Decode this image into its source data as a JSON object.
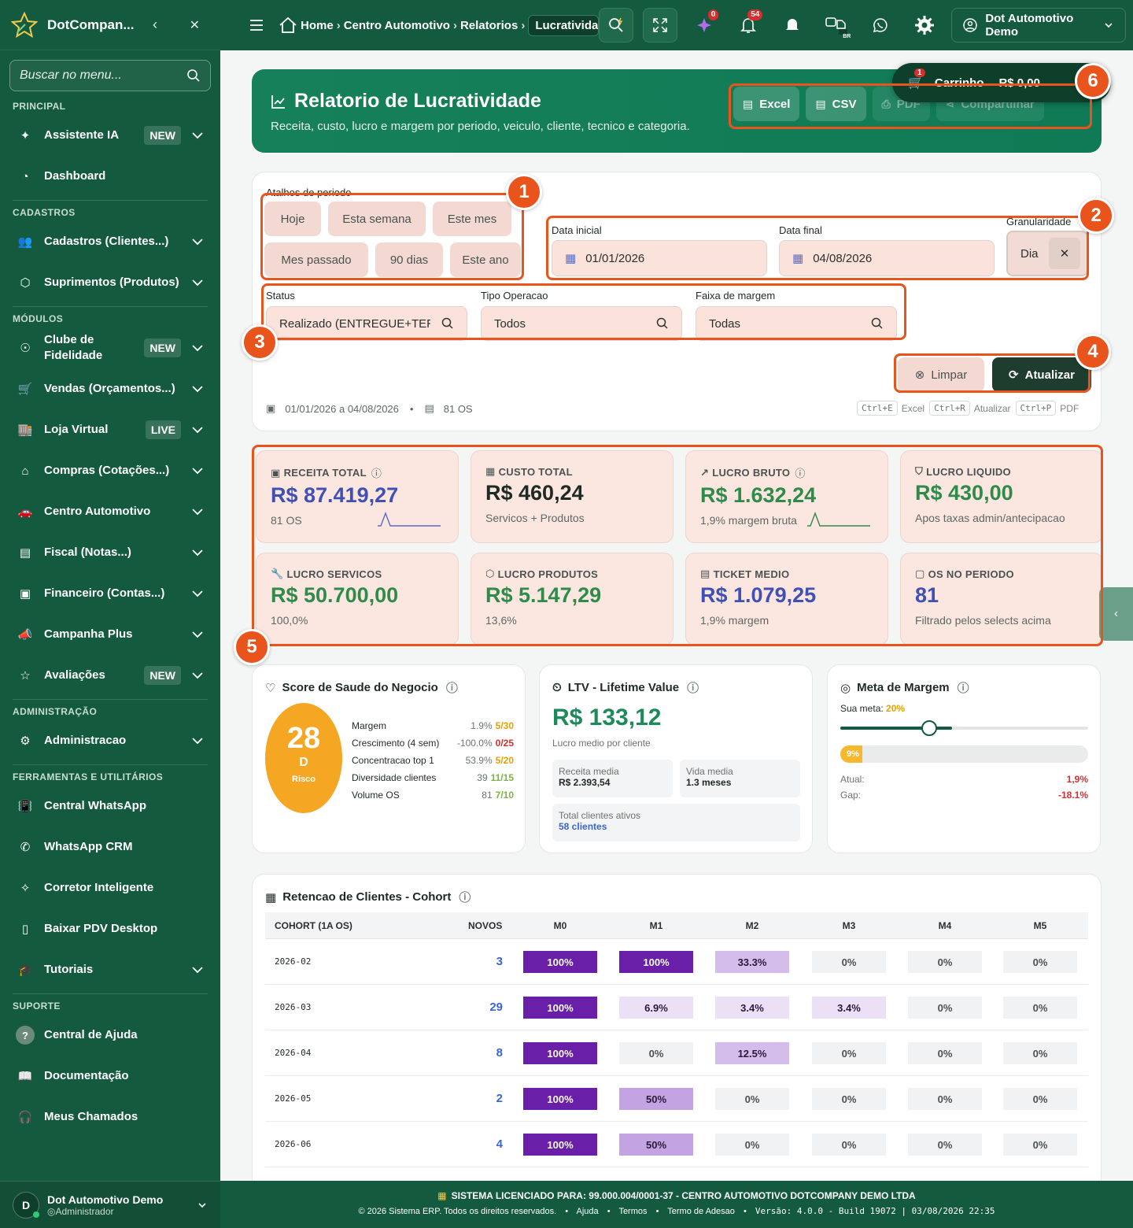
{
  "sidebar": {
    "brand": "DotCompan...",
    "search_placeholder": "Buscar no menu...",
    "sections": [
      "PRINCIPAL",
      "CADASTROS",
      "MÓDULOS",
      "ADMINISTRAÇÃO",
      "FERRAMENTAS E UTILITÁRIOS",
      "SUPORTE"
    ],
    "items": [
      {
        "label": "Assistente IA",
        "badge": "NEW",
        "icon": "sparkle-icon"
      },
      {
        "label": "Dashboard",
        "icon": "gauge-icon"
      },
      {
        "label": "Cadastros (Clientes...)",
        "icon": "users-icon"
      },
      {
        "label": "Suprimentos (Produtos)",
        "icon": "box-icon"
      },
      {
        "label": "Clube de Fidelidade",
        "badge": "NEW",
        "icon": "medal-icon"
      },
      {
        "label": "Vendas (Orçamentos...)",
        "icon": "cart-icon"
      },
      {
        "label": "Loja Virtual",
        "badge": "LIVE",
        "icon": "store-icon"
      },
      {
        "label": "Compras (Cotações...)",
        "icon": "basket-icon"
      },
      {
        "label": "Centro Automotivo",
        "icon": "car-icon"
      },
      {
        "label": "Fiscal (Notas...)",
        "icon": "receipt-icon"
      },
      {
        "label": "Financeiro (Contas...)",
        "icon": "cash-icon"
      },
      {
        "label": "Campanha Plus",
        "icon": "megaphone-icon"
      },
      {
        "label": "Avaliações",
        "badge": "NEW",
        "icon": "star-icon"
      },
      {
        "label": "Administracao",
        "icon": "gear-icon"
      },
      {
        "label": "Central WhatsApp",
        "icon": "vibrate-icon"
      },
      {
        "label": "WhatsApp CRM",
        "icon": "whatsapp-icon"
      },
      {
        "label": "Corretor Inteligente",
        "icon": "wand-icon"
      },
      {
        "label": "Baixar PDV Desktop",
        "icon": "devices-icon"
      },
      {
        "label": "Tutoriais",
        "icon": "cap-icon"
      },
      {
        "label": "Central de Ajuda",
        "icon": "help-icon"
      },
      {
        "label": "Documentação",
        "icon": "book-icon"
      },
      {
        "label": "Meus Chamados",
        "icon": "headset-icon"
      }
    ],
    "user": {
      "initial": "D",
      "name": "Dot Automotivo Demo",
      "role": "Administrador"
    }
  },
  "topbar": {
    "breadcrumb": [
      "Home",
      "Centro Automotivo",
      "Relatorios",
      "Lucratividade"
    ],
    "counts": {
      "ai": "0",
      "notifications": "54"
    },
    "lang": "BR",
    "user": "Dot Automotivo Demo"
  },
  "cart": {
    "count": "1",
    "label": "Carrinho",
    "total": "R$ 0,00"
  },
  "hero": {
    "title": "Relatorio de Lucratividade",
    "subtitle": "Receita, custo, lucro e margem por periodo, veiculo, cliente, tecnico e categoria.",
    "actions": [
      "Excel",
      "CSV",
      "PDF",
      "Compartilhar"
    ]
  },
  "filters": {
    "shortcuts_label": "Atalhos de periodo",
    "shortcuts": [
      "Hoje",
      "Esta semana",
      "Este mes",
      "Mes passado",
      "90 dias",
      "Este ano"
    ],
    "date_start_label": "Data inicial",
    "date_start": "01/01/2026",
    "date_end_label": "Data final",
    "date_end": "04/08/2026",
    "granularity_label": "Granularidade",
    "granularity": "Dia",
    "status_label": "Status",
    "status": "Realizado (ENTREGUE+TERM",
    "op_label": "Tipo Operacao",
    "op": "Todos",
    "margin_label": "Faixa de margem",
    "margin": "Todas",
    "clear": "Limpar",
    "refresh": "Atualizar",
    "summary_range": "01/01/2026 a 04/08/2026",
    "summary_os": "81 OS",
    "shortcuts_keys": [
      {
        "key": "Ctrl+E",
        "label": "Excel"
      },
      {
        "key": "Ctrl+R",
        "label": "Atualizar"
      },
      {
        "key": "Ctrl+P",
        "label": "PDF"
      }
    ]
  },
  "annotations": [
    "1",
    "2",
    "3",
    "4",
    "5",
    "6"
  ],
  "kpis": [
    {
      "title": "RECEITA TOTAL",
      "value": "R$ 87.419,27",
      "sub": "81 OS",
      "color": "#3f51b5",
      "icon": "cash-icon"
    },
    {
      "title": "CUSTO TOTAL",
      "value": "R$ 460,24",
      "sub": "Servicos + Produtos",
      "color": "#1f2a24",
      "icon": "calculator-icon"
    },
    {
      "title": "LUCRO BRUTO",
      "value": "R$ 1.632,24",
      "sub": "1,9% margem bruta",
      "color": "#2e8b4a",
      "icon": "trend-icon"
    },
    {
      "title": "LUCRO LIQUIDO",
      "value": "R$ 430,00",
      "sub": "Apos taxas admin/antecipacao",
      "color": "#2e8b4a",
      "icon": "shield-icon"
    },
    {
      "title": "LUCRO SERVICOS",
      "value": "R$ 50.700,00",
      "sub": "100,0%",
      "color": "#2e8b4a",
      "icon": "wrench-icon"
    },
    {
      "title": "LUCRO PRODUTOS",
      "value": "R$ 5.147,29",
      "sub": "13,6%",
      "color": "#2e8b4a",
      "icon": "box-icon"
    },
    {
      "title": "TICKET MEDIO",
      "value": "R$ 1.079,25",
      "sub": "1,9% margem",
      "color": "#3f51b5",
      "icon": "receipt-icon"
    },
    {
      "title": "OS NO PERIODO",
      "value": "81",
      "sub": "Filtrado pelos selects acima",
      "color": "#3f51b5",
      "icon": "clipboard-icon"
    }
  ],
  "health": {
    "title": "Score de Saude do Negocio",
    "score": "28",
    "grade": "D",
    "status": "Risco",
    "rows": [
      {
        "label": "Margem",
        "value": "1.9%",
        "pts": "5/30",
        "color": "#e6a100"
      },
      {
        "label": "Crescimento (4 sem)",
        "value": "-100.0%",
        "pts": "0/25",
        "color": "#d32f2f"
      },
      {
        "label": "Concentracao top 1",
        "value": "53.9%",
        "pts": "5/20",
        "color": "#e6a100"
      },
      {
        "label": "Diversidade clientes",
        "value": "39",
        "pts": "11/15",
        "color": "#7cb342"
      },
      {
        "label": "Volume OS",
        "value": "81",
        "pts": "7/10",
        "color": "#7cb342"
      }
    ]
  },
  "ltv": {
    "title": "LTV - Lifetime Value",
    "value": "R$ 133,12",
    "caption": "Lucro medio por cliente",
    "rev_label": "Receita media",
    "rev": "R$ 2.393,54",
    "life_label": "Vida media",
    "life": "1.3 meses",
    "clients_label": "Total clientes ativos",
    "clients": "58 clientes"
  },
  "goal": {
    "title": "Meta de Margem",
    "meta_label": "Sua meta:",
    "meta": "20%",
    "meta_pct": 0.36,
    "bar_label": "9%",
    "bar_pct": 0.09,
    "atual_label": "Atual:",
    "atual": "1,9%",
    "gap_label": "Gap:",
    "gap": "-18.1%"
  },
  "cohort": {
    "title": "Retencao de Clientes - Cohort",
    "headers": [
      "COHORT (1A OS)",
      "NOVOS",
      "M0",
      "M1",
      "M2",
      "M3",
      "M4",
      "M5"
    ],
    "rows": [
      {
        "cohort": "2026-02",
        "new": "3",
        "cells": [
          "100%",
          "100%",
          "33.3%",
          "0%",
          "0%",
          "0%"
        ]
      },
      {
        "cohort": "2026-03",
        "new": "29",
        "cells": [
          "100%",
          "6.9%",
          "3.4%",
          "3.4%",
          "0%",
          "0%"
        ]
      },
      {
        "cohort": "2026-04",
        "new": "8",
        "cells": [
          "100%",
          "0%",
          "12.5%",
          "0%",
          "0%",
          "0%"
        ]
      },
      {
        "cohort": "2026-05",
        "new": "2",
        "cells": [
          "100%",
          "50%",
          "0%",
          "0%",
          "0%",
          "0%"
        ]
      },
      {
        "cohort": "2026-06",
        "new": "4",
        "cells": [
          "100%",
          "50%",
          "0%",
          "0%",
          "0%",
          "0%"
        ]
      }
    ]
  },
  "footer": {
    "license": "SISTEMA LICENCIADO PARA: 99.000.004/0001-37 - CENTRO AUTOMOTIVO DOTCOMPANY DEMO LTDA",
    "copyright": "© 2026 Sistema ERP. Todos os direitos reservados.",
    "links": [
      "Ajuda",
      "Termos",
      "Termo de Adesao"
    ],
    "version": "Versão: 4.0.0 - Build 19072 | 03/08/2026 22:35"
  }
}
